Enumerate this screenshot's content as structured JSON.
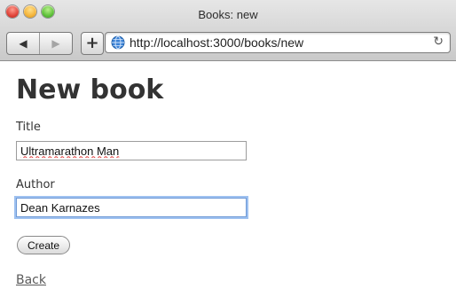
{
  "window": {
    "title": "Books: new"
  },
  "toolbar": {
    "back_glyph": "◀",
    "forward_glyph": "▶",
    "add_glyph": "+",
    "url": "http://localhost:3000/books/new",
    "reload_glyph": "↻"
  },
  "page": {
    "heading": "New book",
    "title_label": "Title",
    "title_value": "Ultramarathon Man",
    "author_label": "Author",
    "author_value": "Dean Karnazes",
    "create_button": "Create",
    "back_link": "Back"
  },
  "colors": {
    "traffic_close": "#e0443a",
    "traffic_minimize": "#f4b43a",
    "traffic_zoom": "#5fc13a",
    "focus_ring": "#9ec1f0",
    "link": "#5a5a5a"
  }
}
